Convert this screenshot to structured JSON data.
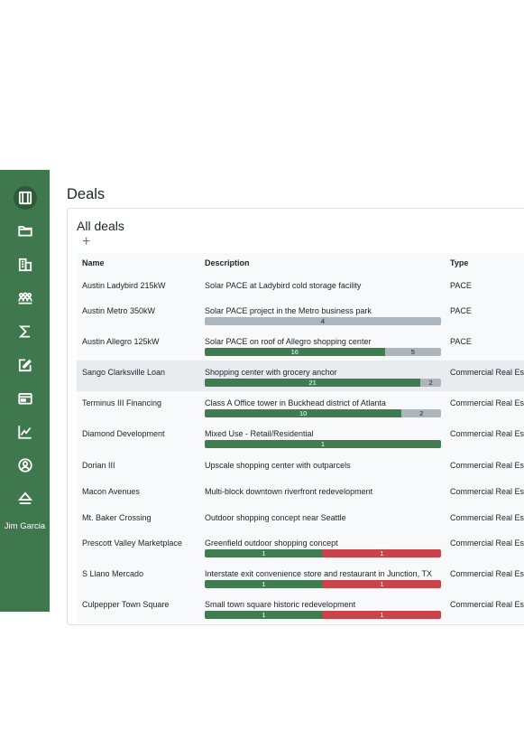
{
  "sidebar": {
    "icons": [
      "deals-icon",
      "folder-icon",
      "building-icon",
      "people-icon",
      "sigma-icon",
      "edit-icon",
      "wallet-icon",
      "chart-icon",
      "user-icon",
      "eject-icon"
    ],
    "user_name": "Jim Garcia"
  },
  "page": {
    "title": "Deals"
  },
  "card": {
    "title": "All deals",
    "add_label": "+"
  },
  "table": {
    "headers": {
      "name": "Name",
      "description": "Description",
      "type": "Type"
    },
    "rows": [
      {
        "name": "Austin Ladybird 215kW",
        "description": "Solar PACE at Ladybird cold storage facility",
        "type": "PACE",
        "bar": []
      },
      {
        "name": "Austin Metro 350kW",
        "description": "Solar PACE project in the Metro business park",
        "type": "PACE",
        "bar": [
          {
            "color": "gray",
            "value": 4
          }
        ]
      },
      {
        "name": "Austin Allegro 125kW",
        "description": "Solar PACE on roof of Allegro shopping center",
        "type": "PACE",
        "bar": [
          {
            "color": "green",
            "value": 16
          },
          {
            "color": "gray",
            "value": 5
          }
        ]
      },
      {
        "name": "Sango Clarksville Loan",
        "description": "Shopping center with grocery anchor",
        "type": "Commercial Real Est",
        "bar": [
          {
            "color": "green",
            "value": 21
          },
          {
            "color": "gray",
            "value": 2
          }
        ],
        "highlight": true
      },
      {
        "name": "Terminus III Financing",
        "description": "Class A Office tower in Buckhead district of Atlanta",
        "type": "Commercial Real Est",
        "bar": [
          {
            "color": "green",
            "value": 10
          },
          {
            "color": "gray",
            "value": 2
          }
        ]
      },
      {
        "name": "Diamond Development",
        "description": "Mixed Use - Retail/Residential",
        "type": "Commercial Real Est",
        "bar": [
          {
            "color": "green",
            "value": 1
          }
        ]
      },
      {
        "name": "Dorian III",
        "description": "Upscale shopping center with outparcels",
        "type": "Commercial Real Est",
        "bar": []
      },
      {
        "name": "Macon Avenues",
        "description": "Multi-block downtown riverfront redevelopment",
        "type": "Commercial Real Est",
        "bar": []
      },
      {
        "name": "Mt. Baker Crossing",
        "description": "Outdoor shopping concept near Seattle",
        "type": "Commercial Real Est",
        "bar": []
      },
      {
        "name": "Prescott Valley Marketplace",
        "description": "Greenfield outdoor shopping concept",
        "type": "Commercial Real Est",
        "bar": [
          {
            "color": "green",
            "value": 1
          },
          {
            "color": "red",
            "value": 1
          }
        ]
      },
      {
        "name": "S Llano Mercado",
        "description": "Interstate exit convenience store and restaurant in Junction, TX",
        "type": "Commercial Real Est",
        "bar": [
          {
            "color": "green",
            "value": 1
          },
          {
            "color": "red",
            "value": 1
          }
        ]
      },
      {
        "name": "Culpepper Town Square",
        "description": "Small town square historic redevelopment",
        "type": "Commercial Real Est",
        "bar": [
          {
            "color": "green",
            "value": 1
          },
          {
            "color": "red",
            "value": 1
          }
        ]
      }
    ]
  }
}
